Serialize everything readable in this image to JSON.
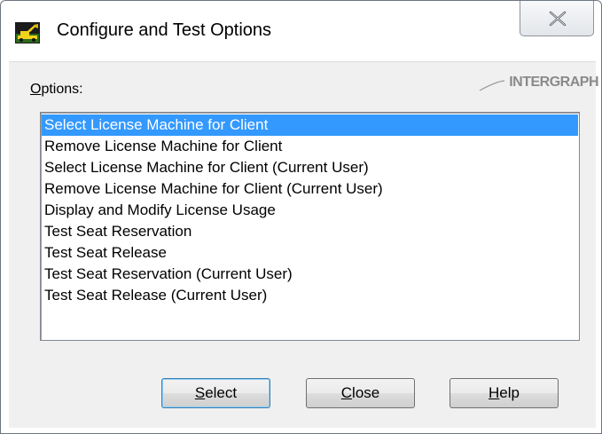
{
  "window": {
    "title": "Configure and Test Options"
  },
  "options_label": {
    "accel": "O",
    "rest": "ptions:"
  },
  "logo": {
    "text": "INTERGRAPH"
  },
  "options_list": {
    "items": [
      "Select License Machine for Client",
      "Remove License Machine for Client",
      "Select License Machine for Client (Current User)",
      "Remove License Machine for Client (Current User)",
      "Display and Modify License Usage",
      "Test Seat Reservation",
      "Test Seat Release",
      "Test Seat Reservation (Current User)",
      "Test Seat Release (Current User)"
    ],
    "selected": "Select License Machine for Client"
  },
  "buttons": {
    "select": {
      "accel": "S",
      "rest": "elect"
    },
    "close": {
      "accel": "C",
      "rest": "lose"
    },
    "help": {
      "accel": "H",
      "rest": "elp"
    }
  },
  "colors": {
    "selection": "#3399ff",
    "dialog_bg": "#f0f0f0"
  },
  "icons": {
    "app": "excavator-app-icon",
    "close": "close-x-icon"
  }
}
